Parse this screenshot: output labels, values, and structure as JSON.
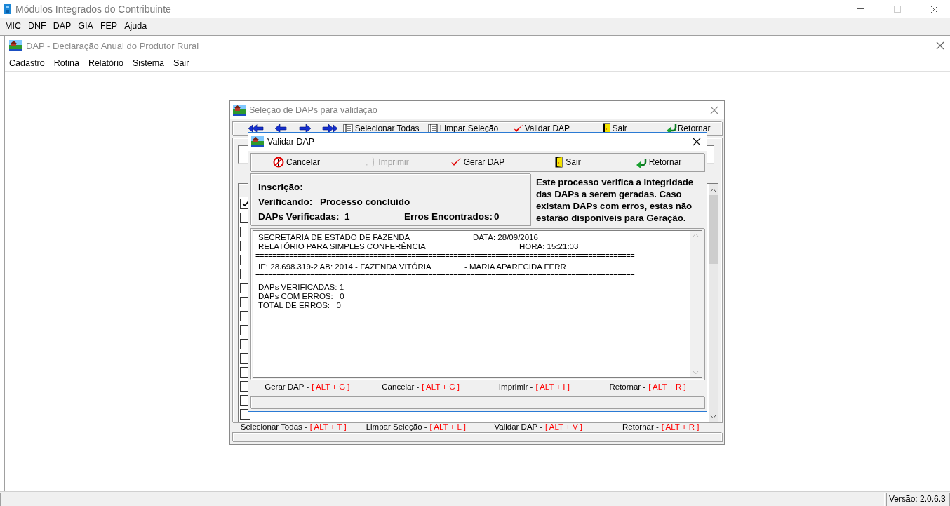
{
  "window": {
    "title": "Módulos Integrados do Contribuinte"
  },
  "menu": [
    {
      "label": "MIC"
    },
    {
      "label": "DNF"
    },
    {
      "label": "DAP"
    },
    {
      "label": "GIA"
    },
    {
      "label": "FEP"
    },
    {
      "label": "Ajuda"
    }
  ],
  "child_window": {
    "title": "DAP - Declaração Anual do Produtor Rural",
    "menu": [
      {
        "label": "Cadastro"
      },
      {
        "label": "Rotina"
      },
      {
        "label": "Relatório"
      },
      {
        "label": "Sistema"
      },
      {
        "label": "Sair"
      }
    ]
  },
  "selection_dialog": {
    "title": "Seleção de DAPs para validação",
    "toolbar": [
      {
        "kind": "first"
      },
      {
        "kind": "prev"
      },
      {
        "kind": "next"
      },
      {
        "kind": "last"
      },
      {
        "kind": "sheets",
        "label": "Selecionar Todas"
      },
      {
        "kind": "sheets",
        "label": "Limpar Seleção"
      },
      {
        "kind": "check",
        "label": "Validar DAP"
      },
      {
        "kind": "exit",
        "label": "Sair"
      },
      {
        "kind": "back",
        "label": "Retornar"
      }
    ],
    "rows": [
      {
        "checked": true
      },
      {
        "checked": false
      },
      {
        "checked": false
      },
      {
        "checked": false
      },
      {
        "checked": false
      },
      {
        "checked": false
      },
      {
        "checked": false
      },
      {
        "checked": false
      },
      {
        "checked": false
      },
      {
        "checked": false
      },
      {
        "checked": false
      },
      {
        "checked": false
      },
      {
        "checked": false
      },
      {
        "checked": false
      },
      {
        "checked": false
      },
      {
        "checked": false
      }
    ],
    "shortcuts": [
      {
        "label": "Selecionar Todas -",
        "keys": "[ ALT + T ]"
      },
      {
        "label": "Limpar Seleção -",
        "keys": "[ ALT + L ]"
      },
      {
        "label": "Validar DAP -",
        "keys": "[ ALT + V ]"
      },
      {
        "label": "Retornar -",
        "keys": "[ ALT + R ]"
      }
    ]
  },
  "validate_dialog": {
    "title": "Validar DAP",
    "toolbar": [
      {
        "kind": "cancel",
        "label": "Cancelar",
        "disabled": false
      },
      {
        "kind": "print",
        "label": "Imprimir",
        "disabled": true
      },
      {
        "kind": "check",
        "label": "Gerar DAP",
        "disabled": false
      },
      {
        "kind": "exit",
        "label": "Sair",
        "disabled": false
      },
      {
        "kind": "back",
        "label": "Retornar",
        "disabled": false
      }
    ],
    "info": {
      "inscricao": {
        "label": "Inscrição:"
      },
      "verificando": {
        "label": "Verificando:",
        "value": "Processo concluído"
      },
      "verificadas": {
        "label": "DAPs Verificadas:",
        "value": "1"
      },
      "erros": {
        "label": "Erros Encontrados:",
        "value": "0"
      }
    },
    "description": "Este processo verifica a integridade das DAPs a serem geradas. Caso existam DAPs com erros, estas não estarão disponíveis para Geração.",
    "report": [
      {
        "kind": "pair",
        "left": "SECRETARIA DE ESTADO DE FAZENDA",
        "right": "DATA: 28/09/2016"
      },
      {
        "kind": "pair",
        "left": "RELATÓRIO PARA SIMPLES CONFERÊNCIA",
        "right": "HORA: 15:21:03"
      },
      {
        "kind": "rule",
        "text": "=========================================================================================="
      },
      {
        "kind": "pair",
        "left": "IE: 28.698.319-2   AB: 2014 - FAZENDA VITÓRIA",
        "right": "- MARIA APARECIDA FERR"
      },
      {
        "kind": "rule",
        "text": "=========================================================================================="
      },
      {
        "kind": "line",
        "text": "DAPs VERIFICADAS: 1"
      },
      {
        "kind": "line",
        "text": "DAPs COM ERROS:   0"
      },
      {
        "kind": "line",
        "text": "TOTAL DE ERROS:   0"
      }
    ],
    "shortcuts": [
      {
        "label": "Gerar DAP -",
        "keys": "[ ALT + G ]"
      },
      {
        "label": "Cancelar -",
        "keys": "[ ALT + C ]"
      },
      {
        "label": "Imprimir -",
        "keys": "[ ALT + I ]"
      },
      {
        "label": "Retornar -",
        "keys": "[ ALT + R ]"
      }
    ]
  },
  "status_bar": {
    "version": "Versão: 2.0.6.3"
  }
}
